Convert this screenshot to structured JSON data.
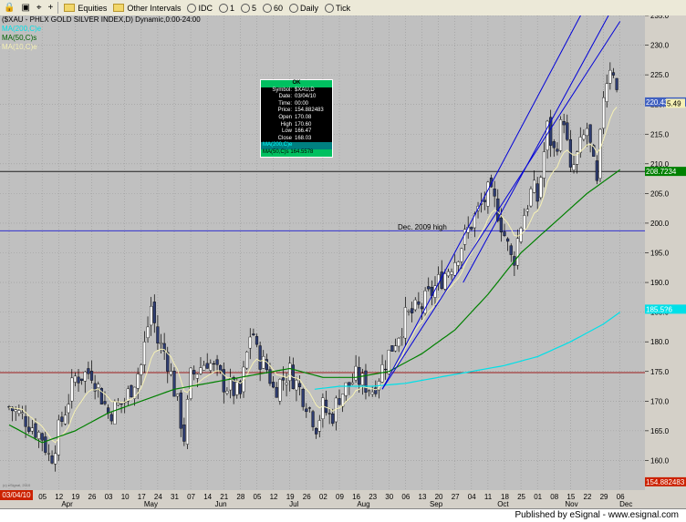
{
  "toolbar": {
    "icons": [
      "lock-icon",
      "new-window-icon",
      "crosshair-icon",
      "plus-icon"
    ],
    "equities_label": "Equities",
    "other_intervals_label": "Other Intervals",
    "intervals": [
      "IDC",
      "1",
      "5",
      "60",
      "Daily",
      "Tick"
    ]
  },
  "header": {
    "title": "($XAU - PHLX GOLD SILVER INDEX,D) Dynamic,0:00-24:00",
    "ma_teal_label": "MA(200,C)e",
    "ma_green_label": "MA(50,C)s",
    "ma_yellow_label": "MA(10,C)e"
  },
  "cursor_box": {
    "header": "OK",
    "rows": [
      {
        "label": "Symbol:",
        "value": "$XAU,D"
      },
      {
        "label": "Date:",
        "value": "03/04/10"
      },
      {
        "label": "Time:",
        "value": "00:00"
      },
      {
        "label": "Price:",
        "value": "154.882483"
      },
      {
        "label": "Open",
        "value": "170.08"
      },
      {
        "label": "High",
        "value": "170.60"
      },
      {
        "label": "Low",
        "value": "166.47"
      },
      {
        "label": "Close",
        "value": "168.03"
      }
    ],
    "ma200_line": "MA(200,C)e",
    "ma50_line": "MA(50,C)s 164.5578"
  },
  "annotations": {
    "dec_high": "Dec. 2009 high",
    "watermark": "(c) eSignal, 2010"
  },
  "price_tags": {
    "last_close": "220.43",
    "ma10_partial": "5.49",
    "ma50": "208.7234",
    "ma200": "185.5?6",
    "cursor_price": "154.882483"
  },
  "status_date": "03/04/10",
  "footer": {
    "text": "Published by eSignal - www.esignal.com"
  },
  "colors": {
    "plot_bg": "#c0c0c0",
    "candle_up": "#ffffff",
    "candle_down": "#2e3c70",
    "ma10": "#f5f0b4",
    "ma50": "#008000",
    "ma200": "#00e0e8",
    "channel": "#0000d8",
    "hline_black": "#202020",
    "hline_red": "#9b1b1b",
    "hline_blue": "#3030d0"
  },
  "chart_data": {
    "type": "candlestick",
    "title": "($XAU - PHLX GOLD SILVER INDEX,D) Dynamic,0:00-24:00",
    "ylim": [
      155,
      235
    ],
    "y_ticks": [
      160,
      165,
      170,
      175,
      180,
      185,
      190,
      195,
      200,
      205,
      210,
      215,
      220,
      225,
      230,
      235
    ],
    "x_tick_labels": [
      "03/04/10",
      "29",
      "05",
      "12",
      "19",
      "26",
      "03",
      "10",
      "17",
      "24",
      "31",
      "07",
      "14",
      "21",
      "28",
      "05",
      "12",
      "19",
      "26",
      "02",
      "09",
      "16",
      "23",
      "30",
      "06",
      "13",
      "20",
      "27",
      "04",
      "11",
      "18",
      "25",
      "01",
      "08",
      "15",
      "22",
      "29",
      "06"
    ],
    "month_labels": [
      "Apr",
      "May",
      "Jun",
      "Jul",
      "Aug",
      "Sep",
      "Oct",
      "Nov",
      "Dec"
    ],
    "week_count": 38,
    "close_anchors": [
      [
        0,
        169
      ],
      [
        1,
        167
      ],
      [
        2,
        164
      ],
      [
        2.5,
        160
      ],
      [
        3,
        165
      ],
      [
        4,
        174
      ],
      [
        5,
        175
      ],
      [
        6,
        168
      ],
      [
        7,
        170
      ],
      [
        8,
        176
      ],
      [
        8.6,
        186
      ],
      [
        9,
        180
      ],
      [
        9.5,
        178
      ],
      [
        10,
        172
      ],
      [
        10.6,
        164
      ],
      [
        11,
        174
      ],
      [
        12,
        177
      ],
      [
        13,
        173
      ],
      [
        14,
        171
      ],
      [
        14.7,
        183
      ],
      [
        15,
        178
      ],
      [
        15.7,
        175
      ],
      [
        16,
        172
      ],
      [
        17,
        175
      ],
      [
        18,
        170
      ],
      [
        18.6,
        166
      ],
      [
        19,
        169
      ],
      [
        19.5,
        167
      ],
      [
        20,
        171
      ],
      [
        21,
        174
      ],
      [
        22,
        172
      ],
      [
        23,
        178
      ],
      [
        24,
        184
      ],
      [
        25,
        186
      ],
      [
        26,
        190
      ],
      [
        27,
        194
      ],
      [
        28,
        200
      ],
      [
        29,
        205
      ],
      [
        29.5,
        203
      ],
      [
        30,
        198
      ],
      [
        30.5,
        193
      ],
      [
        31,
        200
      ],
      [
        31.7,
        206
      ],
      [
        32,
        204
      ],
      [
        32.6,
        216
      ],
      [
        33,
        212
      ],
      [
        33.6,
        218
      ],
      [
        34,
        208
      ],
      [
        34.5,
        212
      ],
      [
        35,
        216
      ],
      [
        35.6,
        206
      ],
      [
        36,
        222
      ],
      [
        36.5,
        228
      ],
      [
        36.9,
        220
      ]
    ],
    "series": [
      {
        "name": "$XAU",
        "values": "daily OHLC candles from 03/04/10 to early Dec 2010 (last close 220.43)"
      },
      {
        "name": "MA(10,C)e",
        "last": 215.49
      },
      {
        "name": "MA(50,C)s",
        "last": 208.7234
      },
      {
        "name": "MA(200,C)e",
        "last": 185.5
      }
    ],
    "ma50_anchors": [
      [
        0,
        166
      ],
      [
        2,
        163
      ],
      [
        4,
        165
      ],
      [
        6,
        168
      ],
      [
        8,
        170
      ],
      [
        10,
        172
      ],
      [
        12,
        173
      ],
      [
        14,
        174
      ],
      [
        16,
        175
      ],
      [
        17,
        175.5
      ],
      [
        19,
        174
      ],
      [
        21,
        174
      ],
      [
        23,
        175
      ],
      [
        25,
        178
      ],
      [
        27,
        182
      ],
      [
        29,
        188
      ],
      [
        31,
        195
      ],
      [
        33,
        200
      ],
      [
        35,
        205
      ],
      [
        37,
        209
      ]
    ],
    "ma200_anchors": [
      [
        18.5,
        172
      ],
      [
        20,
        172.5
      ],
      [
        22,
        172.5
      ],
      [
        24,
        173
      ],
      [
        26,
        174
      ],
      [
        28,
        175
      ],
      [
        30,
        176
      ],
      [
        32,
        177.5
      ],
      [
        34,
        180
      ],
      [
        36,
        183
      ],
      [
        37,
        185
      ]
    ],
    "horizontal_lines": [
      {
        "y": 208.7,
        "color": "black"
      },
      {
        "y": 198.7,
        "color": "blue",
        "label": "Dec. 2009 high"
      },
      {
        "y": 174.8,
        "color": "red"
      }
    ],
    "channel_lines": [
      {
        "from": [
          22.6,
          172
        ],
        "to": [
          34.8,
          236
        ]
      },
      {
        "from": [
          22.6,
          172
        ],
        "to": [
          37.0,
          234
        ]
      },
      {
        "from": [
          27.5,
          190
        ],
        "to": [
          36.3,
          235
        ]
      }
    ]
  }
}
